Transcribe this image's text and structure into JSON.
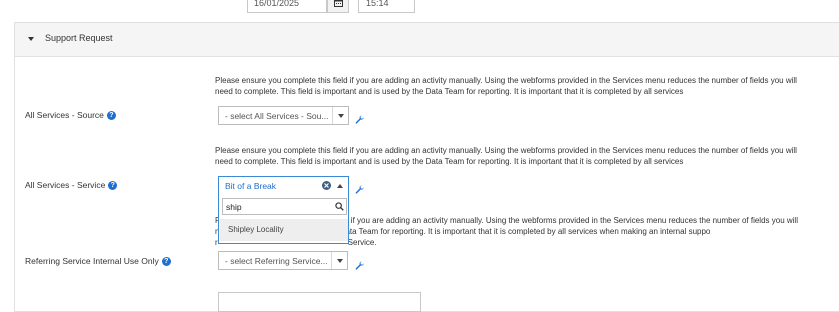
{
  "top_row": {
    "date_value": "16/01/2025",
    "time_value": "15:14"
  },
  "section": {
    "title": "Support Request"
  },
  "fields": {
    "source": {
      "help_line1": "Please ensure you complete this field if you are adding an activity manually. Using the webforms provided in the Services menu reduces the number of fields you will",
      "help_line2": "need to complete. This field is important and is used by the Data Team for reporting. It is important that it is completed by all services",
      "label": "All Services - Source",
      "value": "- select All Services - Sou..."
    },
    "service": {
      "help_line1": "Please ensure you complete this field if you are adding an activity manually. Using the webforms provided in the Services menu reduces the number of fields you will",
      "help_line2": "need to complete. This field is important and is used by the Data Team for reporting. It is important that it is completed by all services",
      "label": "All Services - Service",
      "value": "Bit of a Break",
      "search_text": "ship",
      "result": "Shipley Locality"
    },
    "referring": {
      "help_line1_left": "P",
      "help_line1_right": "ld if you are adding an activity manually. Using the webforms provided in the Services menu reduces the number of fields you will",
      "help_line2_left": "n",
      "help_line2_right": "ata Team for reporting. It is important that it is completed by all services when making an internal suppo",
      "help_line3_left": "r",
      "help_line3_right": "Service.",
      "label": "Referring Service Internal Use Only",
      "value": "- select Referring Service..."
    }
  },
  "colors": {
    "accent": "#1d6fd0",
    "focus_border": "#3a8ad8",
    "section_bg": "#f5f5f5"
  }
}
